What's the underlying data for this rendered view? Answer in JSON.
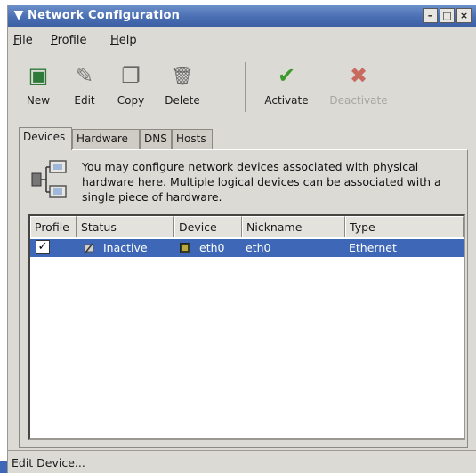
{
  "window": {
    "title": "Network Configuration",
    "menu_glyph": "▼",
    "minimize": "–",
    "maximize": "□",
    "close": "×"
  },
  "menubar": {
    "file": {
      "mnemonic": "F",
      "rest": "ile"
    },
    "profile": {
      "mnemonic": "P",
      "rest": "rofile"
    },
    "help": {
      "mnemonic": "H",
      "rest": "elp"
    }
  },
  "toolbar": {
    "new": {
      "label": "New",
      "icon": "new-device-icon",
      "glyph": "▣"
    },
    "edit": {
      "label": "Edit",
      "icon": "edit-wrench-icon",
      "glyph": "✎"
    },
    "copy": {
      "label": "Copy",
      "icon": "copy-icon",
      "glyph": "❐"
    },
    "delete": {
      "label": "Delete",
      "icon": "trash-can-icon",
      "glyph": "🗑"
    },
    "activate": {
      "label": "Activate",
      "icon": "checkmark-icon",
      "glyph": "✔"
    },
    "deactivate": {
      "label": "Deactivate",
      "icon": "x-mark-icon",
      "glyph": "✖",
      "disabled": true
    }
  },
  "tabs": [
    {
      "label": "Devices",
      "active": true
    },
    {
      "label": "Hardware",
      "active": false
    },
    {
      "label": "DNS",
      "active": false
    },
    {
      "label": "Hosts",
      "active": false
    }
  ],
  "panel": {
    "info_text": "You may configure network devices associated with physical hardware here.  Multiple logical devices can be associated with a single piece of hardware."
  },
  "table": {
    "columns": [
      "Profile",
      "Status",
      "Device",
      "Nickname",
      "Type"
    ],
    "rows": [
      {
        "profile_checked": true,
        "check_glyph": "✓",
        "status": "Inactive",
        "device": "eth0",
        "nickname": "eth0",
        "type": "Ethernet"
      }
    ]
  },
  "statusbar": {
    "text": "Edit Device..."
  },
  "colors": {
    "titlebar": "#4a6fb3",
    "selection": "#3e68b7",
    "window_bg": "#dcdad5",
    "activate_green": "#3a9a2a",
    "deactivate_red": "#c86a60"
  }
}
